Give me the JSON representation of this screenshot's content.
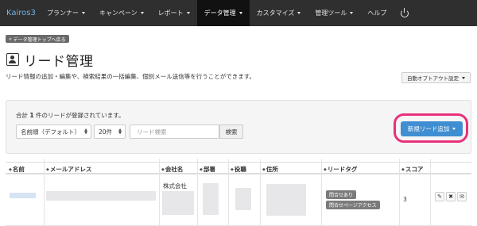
{
  "navbar": {
    "brand": "Kairos3",
    "items": [
      {
        "label": "プランナー",
        "dropdown": true
      },
      {
        "label": "キャンペーン",
        "dropdown": true
      },
      {
        "label": "レポート",
        "dropdown": true
      },
      {
        "label": "データ管理",
        "dropdown": true,
        "active": true
      },
      {
        "label": "カスタマイズ",
        "dropdown": true
      },
      {
        "label": "管理ツール",
        "dropdown": true
      },
      {
        "label": "ヘルプ",
        "dropdown": false
      }
    ],
    "power_icon": "power-icon"
  },
  "back_button": {
    "label": "データ管理トップへ戻る",
    "icon": "double-left-arrow-icon"
  },
  "page": {
    "title": "リード管理",
    "title_icon": "user-card-icon",
    "description": "リード情報の追加・編集や、検索結果の一括編集、個別メール送信等を行うことができます。",
    "auto_opt_out_button": "自動オプトアウト設定"
  },
  "search_panel": {
    "count_prefix": "合計",
    "count_value": "1",
    "count_suffix": "件のリードが登録されています。",
    "sort_select": "名前順（デフォルト）",
    "per_page_select": "20件",
    "search_placeholder": "リード検索",
    "search_button": "検索",
    "new_lead_button": "新規リード追加",
    "highlight_color": "#e9307a",
    "accent_color": "#3f8ed2"
  },
  "table": {
    "columns": [
      "名前",
      "メールアドレス",
      "会社名",
      "部署",
      "役職",
      "住所",
      "リードタグ",
      "スコア"
    ],
    "rows": [
      {
        "company": "株式会社",
        "tags": [
          "問合せあり",
          "問合せページアクセス"
        ],
        "score": "3"
      }
    ],
    "actions": [
      {
        "name": "edit-icon",
        "glyph": "✎"
      },
      {
        "name": "delete-icon",
        "glyph": "✖"
      },
      {
        "name": "mail-icon",
        "glyph": "✉"
      }
    ]
  }
}
